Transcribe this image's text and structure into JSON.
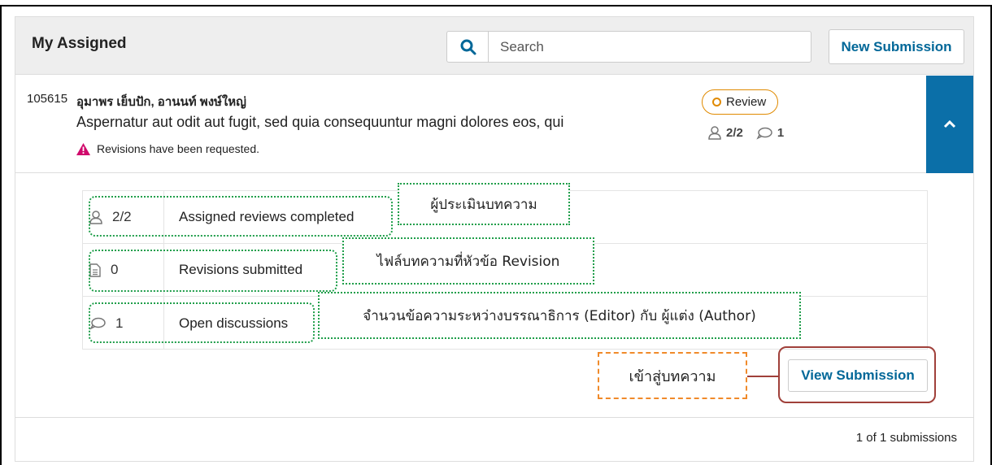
{
  "header": {
    "title": "My Assigned",
    "search_placeholder": "Search",
    "new_submission_label": "New Submission"
  },
  "submission": {
    "id": "105615",
    "authors": "อุมาพร เย็บปัก, อานนท์ พงษ์ใหญ่",
    "title": "Aspernatur aut odit aut fugit, sed quia consequuntur magni dolores eos, qui",
    "alert": "Revisions have been requested.",
    "stage": "Review",
    "reviews_count": "2/2",
    "discussions_count": "1"
  },
  "details": {
    "rows": [
      {
        "icon": "user-icon",
        "value": "2/2",
        "label": "Assigned reviews completed"
      },
      {
        "icon": "file-icon",
        "value": "0",
        "label": "Revisions submitted"
      },
      {
        "icon": "comment-icon",
        "value": "1",
        "label": "Open discussions"
      }
    ],
    "view_submission_label": "View Submission"
  },
  "annotations": {
    "reviewers": "ผู้ประเมินบทความ",
    "revision_files": "ไฟล์บทความที่หัวข้อ Revision",
    "discussions": "จำนวนข้อความระหว่างบรรณาธิการ (Editor) กับ ผู้แต่ง (Author)",
    "enter_article": "เข้าสู่บทความ"
  },
  "footer": {
    "count_text": "1 of 1 submissions"
  },
  "colors": {
    "link_blue": "#006798",
    "expand_blue": "#0b6fa8",
    "review_orange": "#e08a00",
    "alert_red": "#d00a6c",
    "annotation_green": "#1f9e4a",
    "annotation_orange": "#f08a2a",
    "highlight_red": "#a0403a"
  }
}
